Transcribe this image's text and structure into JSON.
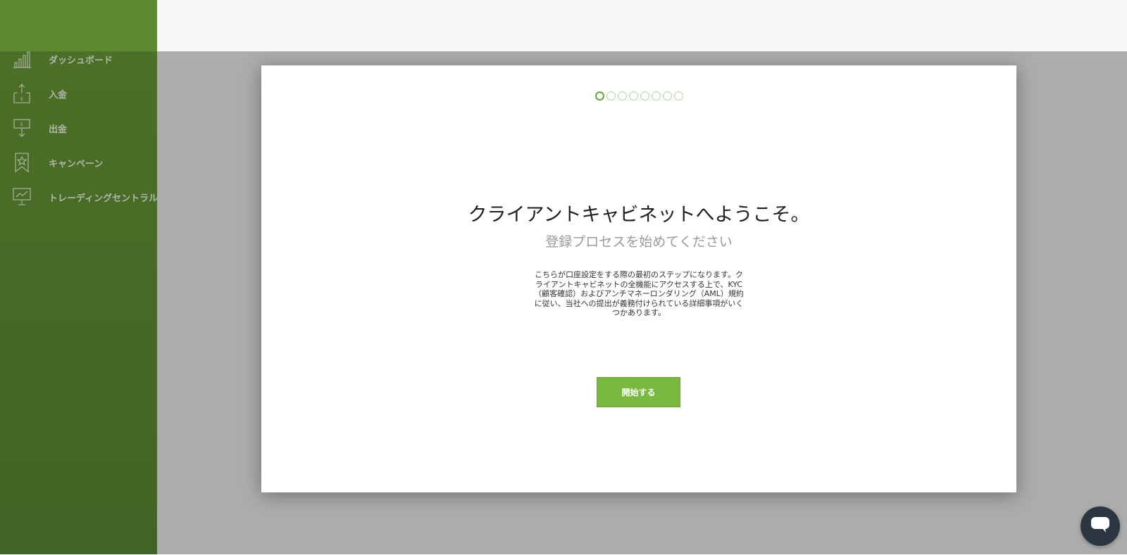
{
  "sidebar": {
    "items": [
      {
        "label": "ダッシュボード",
        "icon": "bar-chart-icon"
      },
      {
        "label": "入金",
        "icon": "deposit-icon"
      },
      {
        "label": "出金",
        "icon": "withdraw-icon"
      },
      {
        "label": "キャンペーン",
        "icon": "star-bookmark-icon"
      },
      {
        "label": "トレーディングセントラル",
        "icon": "trading-monitor-icon"
      }
    ]
  },
  "modal": {
    "steps_total": 8,
    "steps_current": 1,
    "title": "クライアントキャビネットへようこそ。",
    "subtitle": "登録プロセスを始めてください",
    "description": "こちらが口座設定をする際の最初のステップになります。クライアントキャビネットの全機能にアクセスする上で、KYC（顧客確認）およびアンチマネーロンダリング（AML）規約に従い、当社への提出が義務付けられている詳細事項がいくつかあります。",
    "start_label": "開始する"
  },
  "colors": {
    "sidebar": "#5e8a30",
    "accent": "#79b83e",
    "overlay": "#acacac",
    "chat": "#2b3640"
  },
  "chat": {
    "icon": "chat-bubble-icon"
  }
}
